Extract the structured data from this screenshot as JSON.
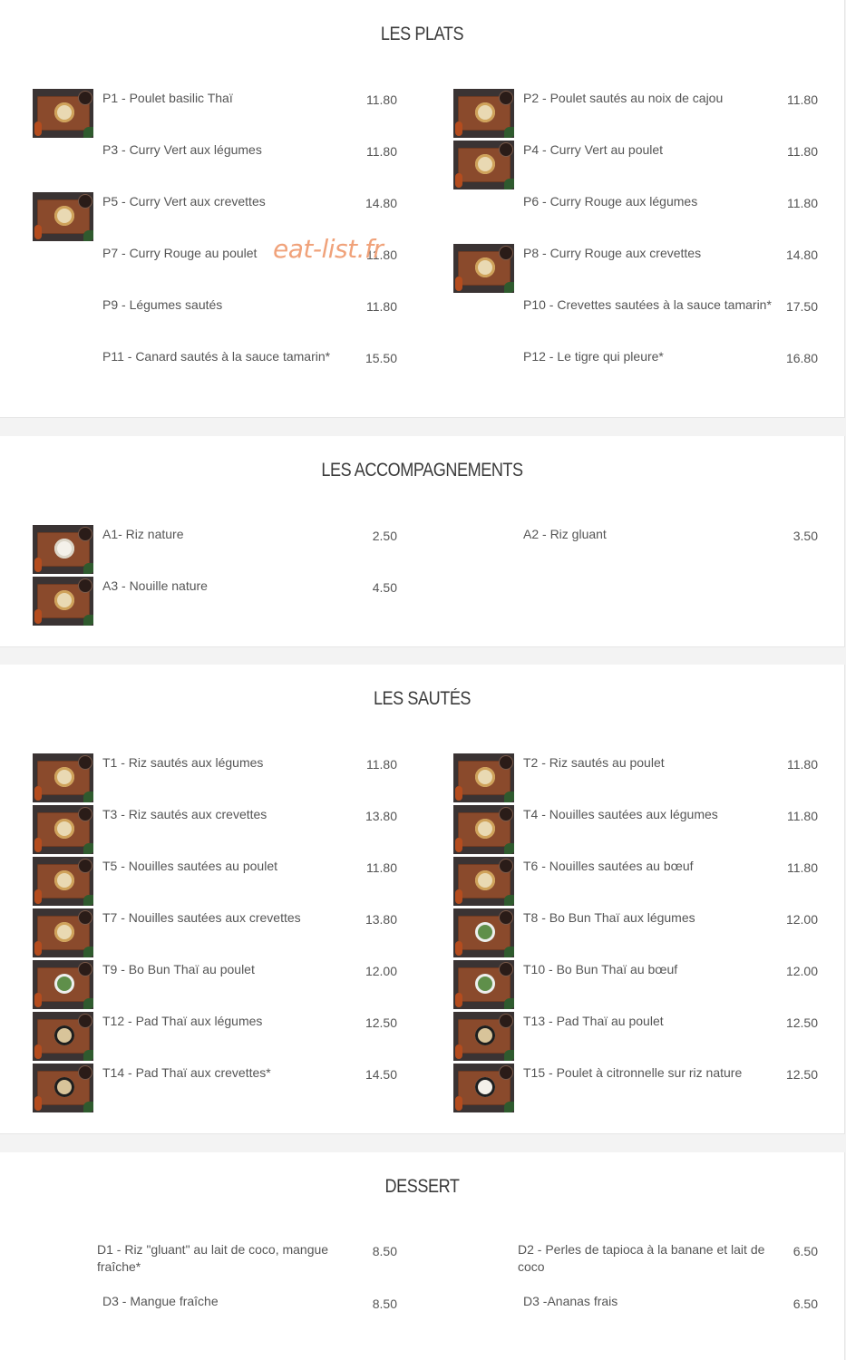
{
  "watermark": "eat-list.fr",
  "sections": {
    "plats": {
      "title": "LES PLATS",
      "items": [
        {
          "name": "P1 - Poulet basilic Thaï",
          "price": "11.80"
        },
        {
          "name": "P2 - Poulet sautés au noix de cajou",
          "price": "11.80"
        },
        {
          "name": "P3 - Curry Vert aux légumes",
          "price": "11.80"
        },
        {
          "name": "P4 - Curry Vert au poulet",
          "price": "11.80"
        },
        {
          "name": "P5 - Curry Vert aux crevettes",
          "price": "14.80"
        },
        {
          "name": "P6 - Curry Rouge aux légumes",
          "price": "11.80"
        },
        {
          "name": "P7 - Curry Rouge au poulet",
          "price": "11.80"
        },
        {
          "name": "P8 - Curry Rouge aux crevettes",
          "price": "14.80"
        },
        {
          "name": "P9 - Légumes sautés",
          "price": "11.80"
        },
        {
          "name": "P10 - Crevettes sautées à la sauce tamarin*",
          "price": "17.50"
        },
        {
          "name": "P11 - Canard sautés à la sauce tamarin*",
          "price": "15.50"
        },
        {
          "name": "P12 - Le tigre qui pleure*",
          "price": "16.80"
        }
      ]
    },
    "accompagnements": {
      "title": "LES ACCOMPAGNEMENTS",
      "items": [
        {
          "name": "A1- Riz nature",
          "price": "2.50"
        },
        {
          "name": "A2 - Riz gluant",
          "price": "3.50"
        },
        {
          "name": "A3 - Nouille nature",
          "price": "4.50"
        }
      ]
    },
    "sautes": {
      "title": "LES SAUTÉS",
      "items": [
        {
          "name": "T1 - Riz sautés aux légumes",
          "price": "11.80"
        },
        {
          "name": "T2 - Riz sautés au poulet",
          "price": "11.80"
        },
        {
          "name": "T3 - Riz sautés aux crevettes",
          "price": "13.80"
        },
        {
          "name": "T4 - Nouilles sautées aux légumes",
          "price": "11.80"
        },
        {
          "name": "T5 - Nouilles sautées au poulet",
          "price": "11.80"
        },
        {
          "name": "T6 - Nouilles sautées au bœuf",
          "price": "11.80"
        },
        {
          "name": "T7 - Nouilles sautées aux crevettes",
          "price": "13.80"
        },
        {
          "name": "T8 - Bo Bun Thaï aux légumes",
          "price": "12.00"
        },
        {
          "name": "T9 - Bo Bun Thaï au poulet",
          "price": "12.00"
        },
        {
          "name": "T10 - Bo Bun Thaï au bœuf",
          "price": "12.00"
        },
        {
          "name": "T12 - Pad Thaï aux légumes",
          "price": "12.50"
        },
        {
          "name": "T13 - Pad Thaï au poulet",
          "price": "12.50"
        },
        {
          "name": "T14 - Pad Thaï aux crevettes*",
          "price": "14.50"
        },
        {
          "name": "T15 - Poulet à citronnelle sur riz nature",
          "price": "12.50"
        }
      ]
    },
    "dessert": {
      "title": "DESSERT",
      "items": [
        {
          "name": "D1 - Riz \"gluant\" au lait de coco, mangue fraîche*",
          "price": "8.50"
        },
        {
          "name": "D2 - Perles de tapioca à la banane et lait de coco",
          "price": "6.50"
        },
        {
          "name": "D3 - Mangue fraîche",
          "price": "8.50"
        },
        {
          "name": "D3 -Ananas frais",
          "price": "6.50"
        }
      ]
    }
  }
}
